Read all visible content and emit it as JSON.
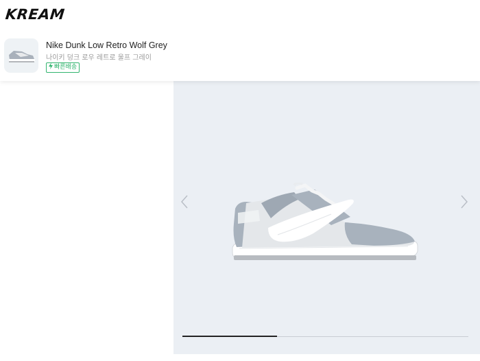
{
  "brand": {
    "logo_text": "KREAM"
  },
  "product": {
    "name_en": "Nike Dunk Low Retro Wolf Grey",
    "name_ko": "나이키 덩크 로우 레트로 울프 그레이",
    "badge_label": "빠른배송",
    "badge_color": "#31b46e"
  },
  "gallery": {
    "background": "#ebeff4",
    "slide_progress": 0.33,
    "prev_icon": "chevron-left-icon",
    "next_icon": "chevron-right-icon"
  }
}
